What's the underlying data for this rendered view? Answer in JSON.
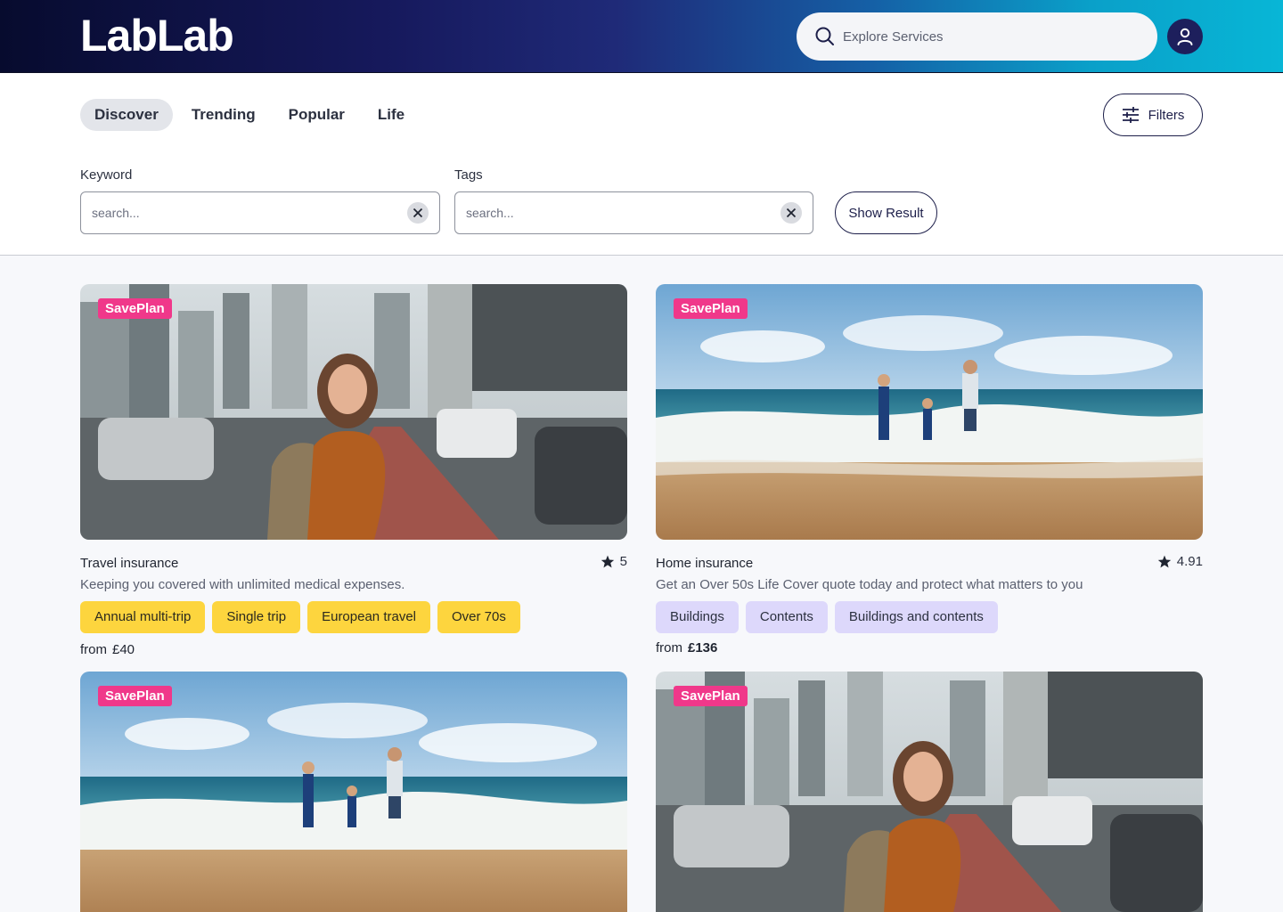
{
  "header": {
    "logo": "LabLab",
    "search_placeholder": "Explore Services"
  },
  "tabs": [
    {
      "label": "Discover",
      "active": true
    },
    {
      "label": "Trending",
      "active": false
    },
    {
      "label": "Popular",
      "active": false
    },
    {
      "label": "Life",
      "active": false
    }
  ],
  "filters_label": "Filters",
  "search_form": {
    "keyword_label": "Keyword",
    "keyword_placeholder": "search...",
    "tags_label": "Tags",
    "tags_placeholder": "search...",
    "submit_label": "Show Result"
  },
  "cards": [
    {
      "badge": "SavePlan",
      "image": "city-woman",
      "title": "Travel insurance",
      "rating": "5",
      "description": "Keeping you covered with unlimited medical expenses.",
      "tags": [
        "Annual multi-trip",
        "Single trip",
        "European travel",
        "Over 70s"
      ],
      "tag_color": "#fdd53e",
      "price_prefix": "from",
      "price": "£40"
    },
    {
      "badge": "SavePlan",
      "image": "beach-family",
      "title": "Home insurance",
      "rating": "4.91",
      "description": "Get an Over 50s Life Cover quote today and protect what matters to you",
      "tags": [
        "Buildings",
        "Contents",
        "Buildings and contents"
      ],
      "tag_color": "#ddd8fb",
      "price_prefix": "from",
      "price": "£136"
    },
    {
      "badge": "SavePlan",
      "image": "beach-family"
    },
    {
      "badge": "SavePlan",
      "image": "city-woman"
    }
  ],
  "colors": {
    "badge": "#f0388a",
    "accent_navy": "#1d1f4a"
  }
}
